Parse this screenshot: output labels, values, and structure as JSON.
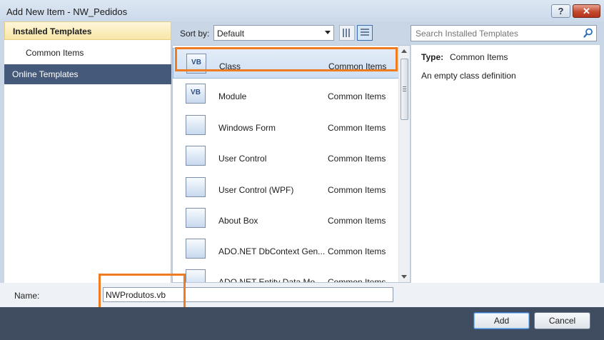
{
  "window": {
    "title": "Add New Item - NW_Pedidos",
    "help_glyph": "?",
    "close_glyph": "✕"
  },
  "sidebar": {
    "installed_templates": "Installed Templates",
    "items": [
      {
        "label": "Common Items"
      }
    ],
    "online_templates": "Online Templates"
  },
  "toolbar": {
    "sort_label": "Sort by:",
    "sort_value": "Default",
    "search_placeholder": "Search Installed Templates"
  },
  "templates": [
    {
      "name": "Class",
      "category": "Common Items",
      "icon": "vb-class-icon",
      "glyph": "VB",
      "selected": true
    },
    {
      "name": "Module",
      "category": "Common Items",
      "icon": "vb-module-icon",
      "glyph": "VB",
      "selected": false
    },
    {
      "name": "Windows Form",
      "category": "Common Items",
      "icon": "windows-form-icon",
      "glyph": "",
      "selected": false
    },
    {
      "name": "User Control",
      "category": "Common Items",
      "icon": "user-control-icon",
      "glyph": "",
      "selected": false
    },
    {
      "name": "User Control (WPF)",
      "category": "Common Items",
      "icon": "wpf-user-control-icon",
      "glyph": "",
      "selected": false
    },
    {
      "name": "About Box",
      "category": "Common Items",
      "icon": "about-box-icon",
      "glyph": "",
      "selected": false
    },
    {
      "name": "ADO.NET DbContext Gen...",
      "category": "Common Items",
      "icon": "dbcontext-generator-icon",
      "glyph": "",
      "selected": false
    },
    {
      "name": "ADO.NET Entity Data Mo...",
      "category": "Common Items",
      "icon": "entity-data-model-icon",
      "glyph": "",
      "selected": false
    }
  ],
  "details": {
    "type_label": "Type:",
    "type_value": "Common Items",
    "description": "An empty class definition"
  },
  "name_field": {
    "label": "Name:",
    "value": "NWProdutos.vb"
  },
  "buttons": {
    "add": "Add",
    "cancel": "Cancel"
  },
  "colors": {
    "highlight": "#f07c22",
    "online_templates_bg": "#455a7a",
    "bottom_bar": "#404d61"
  }
}
